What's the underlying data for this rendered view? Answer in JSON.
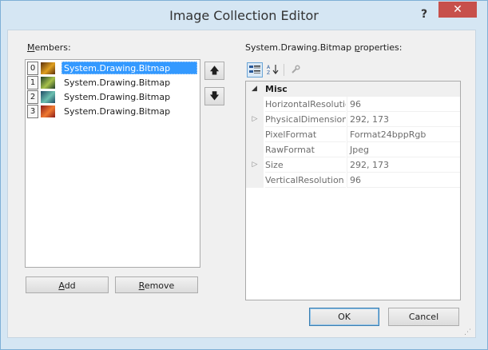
{
  "window": {
    "title": "Image Collection Editor",
    "help_glyph": "?",
    "close_glyph": "✕"
  },
  "members": {
    "label_accel": "M",
    "label_rest": "embers:",
    "items": [
      {
        "index": "0",
        "text": "System.Drawing.Bitmap",
        "selected": true,
        "thumb_colors": [
          "#5a2e0a",
          "#e0a020"
        ]
      },
      {
        "index": "1",
        "text": "System.Drawing.Bitmap",
        "selected": false,
        "thumb_colors": [
          "#1f3d2a",
          "#a8c24a"
        ]
      },
      {
        "index": "2",
        "text": "System.Drawing.Bitmap",
        "selected": false,
        "thumb_colors": [
          "#1e4a66",
          "#6cc0b0"
        ]
      },
      {
        "index": "3",
        "text": "System.Drawing.Bitmap",
        "selected": false,
        "thumb_colors": [
          "#8a1a1a",
          "#f07a30"
        ]
      }
    ],
    "add_accel": "A",
    "add_rest": "dd",
    "remove_accel": "R",
    "remove_rest": "emove",
    "move_up_glyph": "🡅",
    "move_down_glyph": "🡇"
  },
  "properties": {
    "label_pre": "System.Drawing.Bitmap ",
    "label_accel": "p",
    "label_rest": "roperties:",
    "toolbar": {
      "categorized_icon": "categorized-icon",
      "alphabetical_icon": "alphabetical-icon",
      "property_pages_icon": "wrench-icon"
    },
    "category": {
      "expander": "◢",
      "name": "Misc"
    },
    "rows": [
      {
        "expander": "",
        "name": "HorizontalResolution",
        "value": "96"
      },
      {
        "expander": "▷",
        "name": "PhysicalDimension",
        "value": "292, 173"
      },
      {
        "expander": "",
        "name": "PixelFormat",
        "value": "Format24bppRgb"
      },
      {
        "expander": "",
        "name": "RawFormat",
        "value": "Jpeg"
      },
      {
        "expander": "▷",
        "name": "Size",
        "value": "292, 173"
      },
      {
        "expander": "",
        "name": "VerticalResolution",
        "value": "96"
      }
    ]
  },
  "footer": {
    "ok_label": "OK",
    "cancel_label": "Cancel"
  },
  "colors": {
    "selection": "#3399ff",
    "close_button": "#c7504b",
    "frame": "#d5e6f3"
  }
}
